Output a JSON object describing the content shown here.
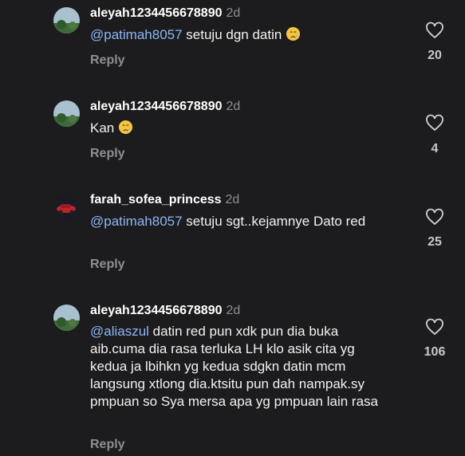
{
  "comments": [
    {
      "username": "aleyah1234456678890",
      "age": "2d",
      "mention": "@patimah8057",
      "text": " setuju dgn datin",
      "reply": "Reply",
      "likes": "20",
      "avatar": "landscape"
    },
    {
      "username": "aleyah1234456678890",
      "age": "2d",
      "mention": "",
      "text": "Kan",
      "reply": "Reply",
      "likes": "4",
      "avatar": "landscape"
    },
    {
      "username": "farah_sofea_princess",
      "age": "2d",
      "mention": "@patimah8057",
      "text": " setuju sgt..kejamnye Dato red",
      "reply": "Reply",
      "likes": "25",
      "avatar": "car"
    },
    {
      "username": "aleyah1234456678890",
      "age": "2d",
      "mention": "@aliaszul",
      "text": " datin red pun xdk pun dia buka aib.cuma dia rasa terluka LH klo asik cita yg kedua ja lbihkn yg kedua sdgkn datin mcm langsung xtlong dia.ktsitu pun dah nampak.sy pmpuan so Sya mersa apa yg pmpuan lain rasa",
      "reply": "Reply",
      "likes": "106",
      "avatar": "landscape"
    }
  ],
  "colors": {
    "background": "#1c1c1e",
    "mention": "#8eb6f5",
    "muted": "#8e8e93"
  },
  "icons": {
    "like": "heart-outline-icon",
    "emoji": "crying-face-emoji"
  }
}
